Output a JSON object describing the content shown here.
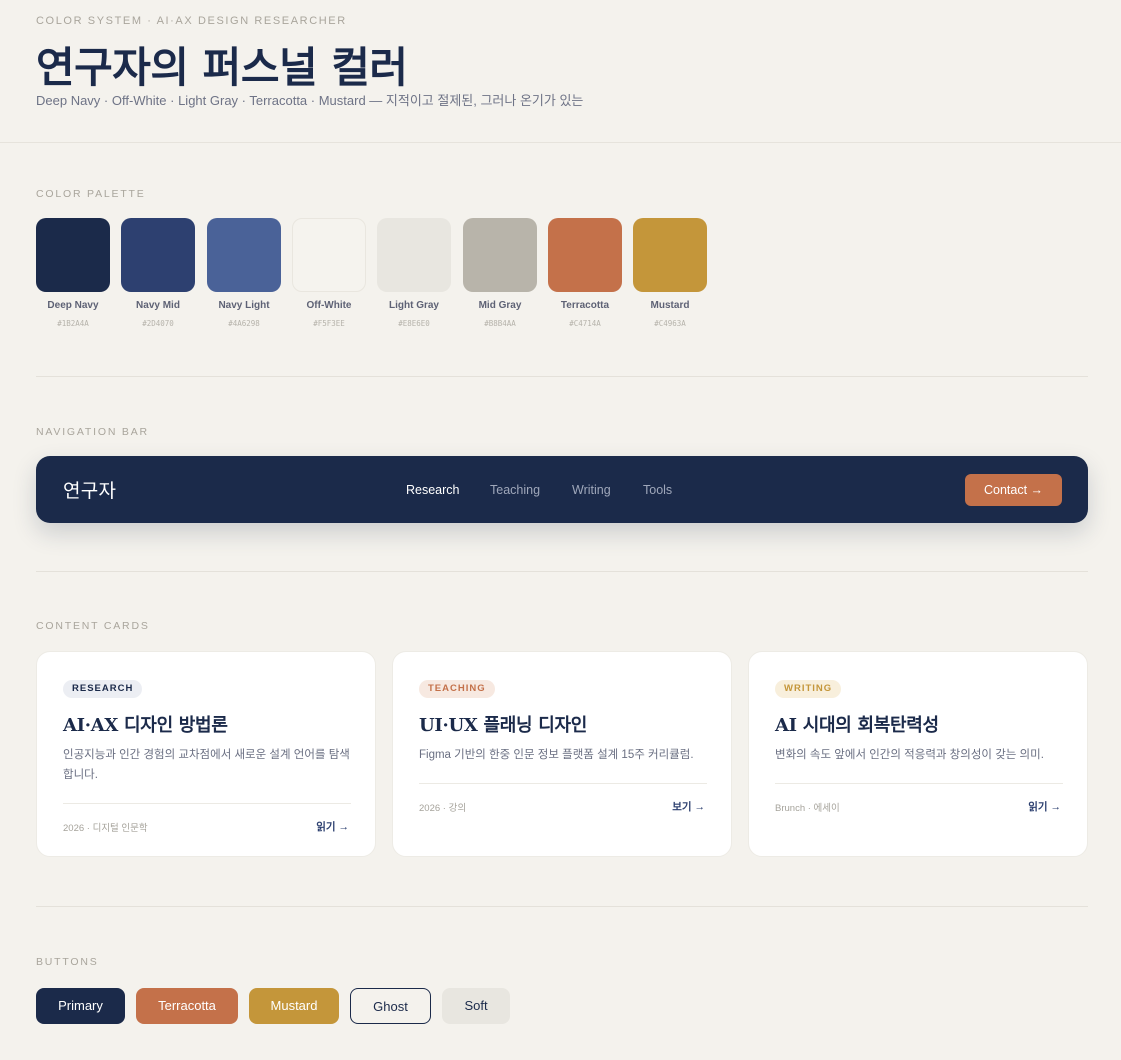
{
  "header": {
    "eyebrow": "COLOR SYSTEM · AI·AX DESIGN RESEARCHER",
    "title": "연구자의 퍼스널 컬러",
    "subtitle": "Deep Navy · Off-White · Light Gray · Terracotta · Mustard — 지적이고 절제된, 그러나 온기가 있는"
  },
  "palette": {
    "label": "COLOR PALETTE",
    "swatches": [
      {
        "name": "Deep Navy",
        "hex": "#1B2A4A"
      },
      {
        "name": "Navy Mid",
        "hex": "#2D4070"
      },
      {
        "name": "Navy Light",
        "hex": "#4A6298"
      },
      {
        "name": "Off-White",
        "hex": "#F5F3EE"
      },
      {
        "name": "Light Gray",
        "hex": "#E8E6E0"
      },
      {
        "name": "Mid Gray",
        "hex": "#B8B4AA"
      },
      {
        "name": "Terracotta",
        "hex": "#C4714A"
      },
      {
        "name": "Mustard",
        "hex": "#C4963A"
      }
    ]
  },
  "nav": {
    "label": "NAVIGATION BAR",
    "brand": "연구자",
    "links": [
      "Research",
      "Teaching",
      "Writing",
      "Tools"
    ],
    "active": "Research",
    "cta": "Contact →"
  },
  "cards": {
    "label": "CONTENT CARDS",
    "items": [
      {
        "tag": "RESEARCH",
        "tag_color": "#1B2A4A",
        "tag_bg": "#ECEEF3",
        "title": "AI·AX 디자인 방법론",
        "desc": "인공지능과 인간 경험의 교차점에서 새로운 설계 언어를 탐색합니다.",
        "meta": "2026 · 디지털 인문학",
        "link": "읽기 →"
      },
      {
        "tag": "TEACHING",
        "tag_color": "#C4714A",
        "tag_bg": "#F7E9E1",
        "title": "UI·UX 플래닝 디자인",
        "desc": "Figma 기반의 한중 인문 정보 플랫폼 설계 15주 커리큘럼.",
        "meta": "2026 · 강의",
        "link": "보기 →"
      },
      {
        "tag": "WRITING",
        "tag_color": "#C4963A",
        "tag_bg": "#F8EFDC",
        "title": "AI 시대의 회복탄력성",
        "desc": "변화의 속도 앞에서 인간의 적응력과 창의성이 갖는 의미.",
        "meta": "Brunch · 에세이",
        "link": "읽기 →"
      }
    ]
  },
  "buttons": {
    "label": "BUTTONS",
    "primary": "Primary",
    "terracotta": "Terracotta",
    "mustard": "Mustard",
    "ghost": "Ghost",
    "soft": "Soft"
  }
}
